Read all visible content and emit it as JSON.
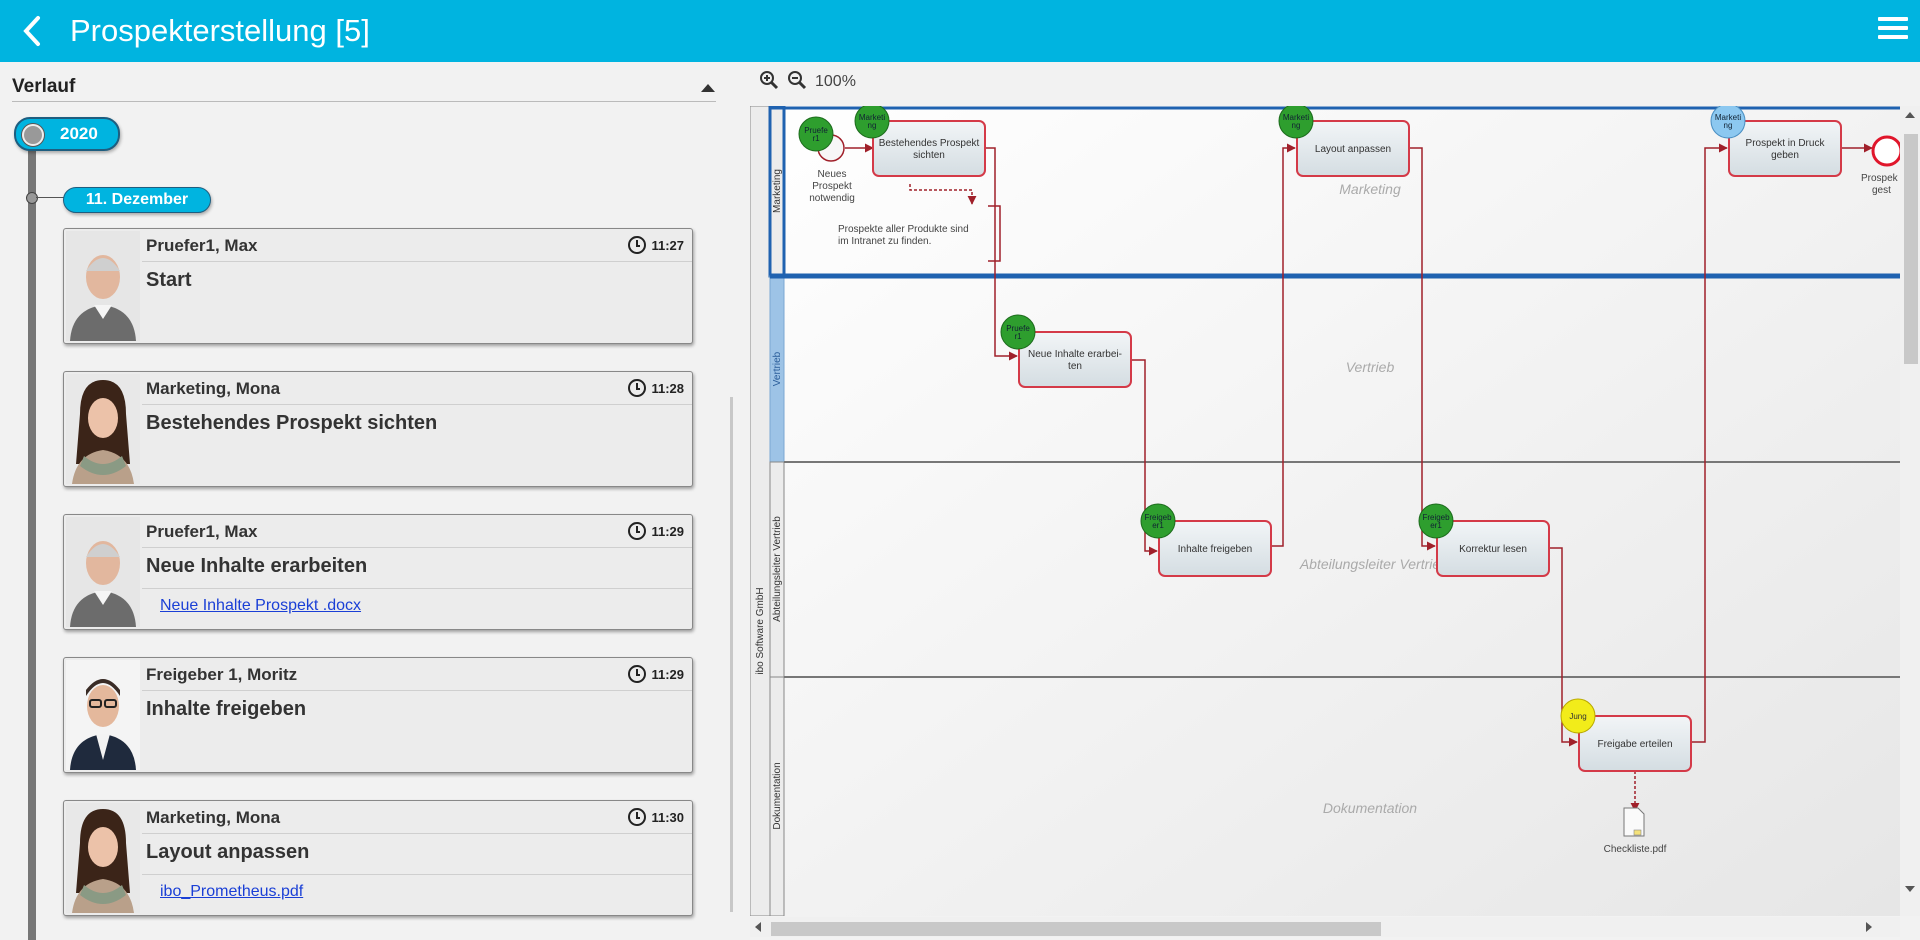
{
  "header": {
    "title": "Prospekterstellung [5]",
    "back_icon": "chevron-left-icon",
    "menu_icon": "hamburger-menu-icon"
  },
  "history": {
    "title": "Verlauf",
    "year": "2020",
    "day": "11. Dezember",
    "entries": [
      {
        "user": "Pruefer1, Max",
        "time": "11:27",
        "action": "Start",
        "file": ""
      },
      {
        "user": "Marketing, Mona",
        "time": "11:28",
        "action": "Bestehendes Prospekt sichten",
        "file": ""
      },
      {
        "user": "Pruefer1, Max",
        "time": "11:29",
        "action": "Neue Inhalte erarbeiten",
        "file": "Neue Inhalte Prospekt .docx"
      },
      {
        "user": "Freigeber 1, Moritz",
        "time": "11:29",
        "action": "Inhalte freigeben",
        "file": ""
      },
      {
        "user": "Marketing, Mona",
        "time": "11:30",
        "action": "Layout anpassen",
        "file": "ibo_Prometheus.pdf"
      }
    ]
  },
  "diagram": {
    "zoom": "100%",
    "pool": "ibo Software GmbH",
    "lanes": [
      {
        "name": "Marketing",
        "watermark": "Marketing"
      },
      {
        "name": "Vertrieb",
        "watermark": "Vertrieb"
      },
      {
        "name": "Abteilungsleiter Vertrieb",
        "watermark": "Abteilungsleiter Vertrie"
      },
      {
        "name": "Dokumentation",
        "watermark": "Dokumentation"
      }
    ],
    "tasks": [
      {
        "label1": "Bestehendes Prospekt",
        "label2": "sichten",
        "role": "Marketi",
        "role2": "ng",
        "status": "done"
      },
      {
        "label1": "Neue Inhalte erarbei-",
        "label2": "ten",
        "role": "Pruefe",
        "role2": "r1",
        "status": "done"
      },
      {
        "label1": "Inhalte freigeben",
        "label2": "",
        "role": "Freigeb",
        "role2": "er1",
        "status": "done"
      },
      {
        "label1": "Layout anpassen",
        "label2": "",
        "role": "Marketi",
        "role2": "ng",
        "status": "done"
      },
      {
        "label1": "Korrektur lesen",
        "label2": "",
        "role": "Freigeb",
        "role2": "er1",
        "status": "done"
      },
      {
        "label1": "Freigabe erteilen",
        "label2": "",
        "role": "Jung",
        "role2": "",
        "status": "pending"
      },
      {
        "label1": "Prospekt in Druck",
        "label2": "geben",
        "role": "Marketi",
        "role2": "ng",
        "status": "active"
      }
    ],
    "start_event": {
      "role": "Pruefe",
      "role2": "r1",
      "label1": "Neues",
      "label2": "Prospekt",
      "label3": "notwendig"
    },
    "end_event": {
      "label1": "Prospek",
      "label2": "gest"
    },
    "annotation": {
      "line1": "Prospekte aller Produkte sind",
      "line2": "im Intranet zu finden."
    },
    "document": "Checkliste.pdf",
    "colors": {
      "done": "#2e9e2e",
      "pending": "#f2ec1a",
      "active": "#8cc8f0",
      "flow": "#a0202a",
      "lane_active": "#1f62b0"
    }
  }
}
